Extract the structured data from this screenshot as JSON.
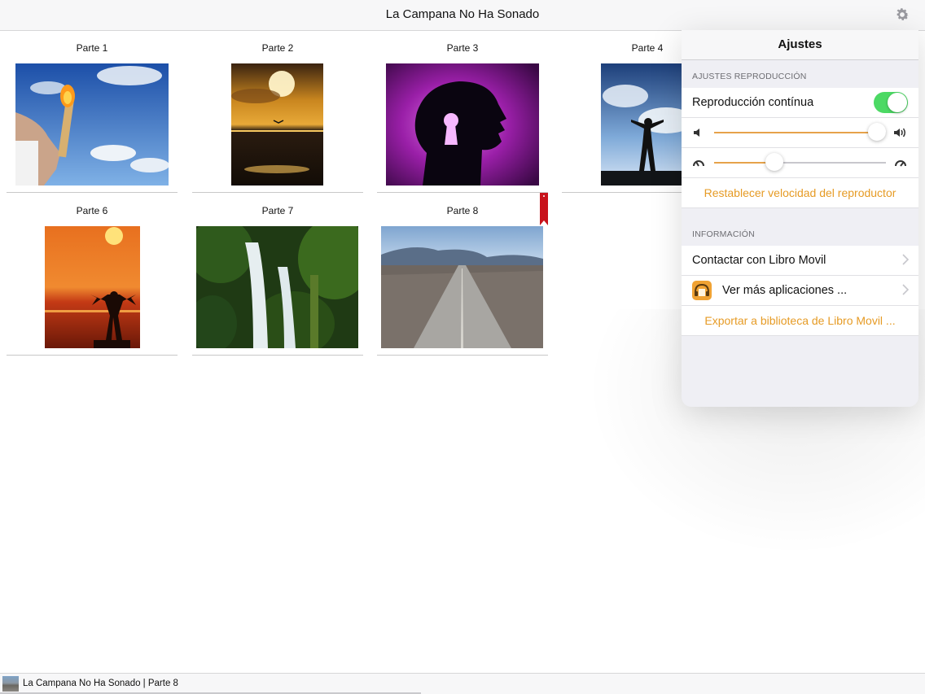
{
  "header": {
    "title": "La Campana No Ha Sonado",
    "settings_icon": "gear-icon"
  },
  "parts": [
    {
      "label": "Parte 1",
      "bookmarked": false
    },
    {
      "label": "Parte 2",
      "bookmarked": false
    },
    {
      "label": "Parte 3",
      "bookmarked": false
    },
    {
      "label": "Parte 4",
      "bookmarked": false
    },
    {
      "label": "Parte 6",
      "bookmarked": false
    },
    {
      "label": "Parte 7",
      "bookmarked": false
    },
    {
      "label": "Parte 8",
      "bookmarked": true
    }
  ],
  "settings": {
    "title": "Ajustes",
    "playback_section": "AJUSTES REPRODUCCIÓN",
    "continuous_label": "Reproducción contínua",
    "continuous_on": true,
    "volume_level": 0.95,
    "speed_level": 0.35,
    "reset_speed_label": "Restablecer velocidad del reproductor",
    "info_section": "INFORMACIÓN",
    "contact_label": "Contactar con Libro Movil",
    "more_apps_label": "Ver más aplicaciones ...",
    "export_label": "Exportar a biblioteca de Libro Movil ...",
    "accent_color": "#e69b25",
    "toggle_color": "#4cd964"
  },
  "player": {
    "now_playing": "La Campana No Ha Sonado | Parte 8",
    "progress": 0.455
  }
}
